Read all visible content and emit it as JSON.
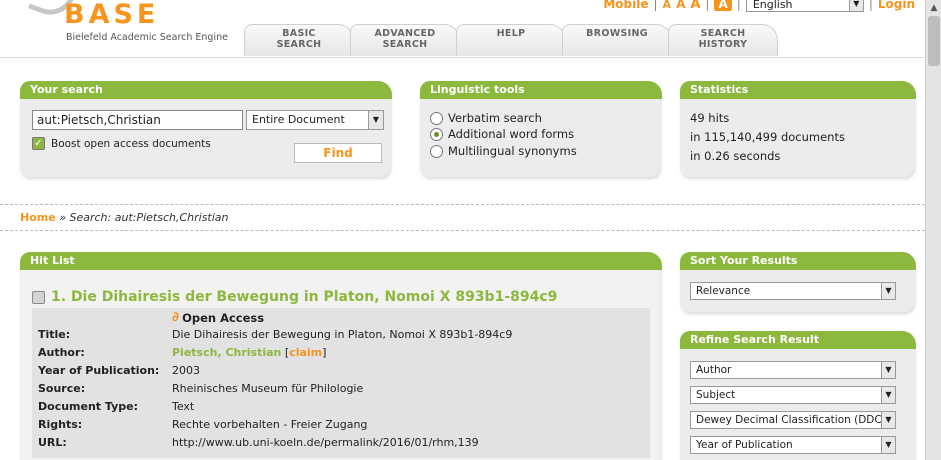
{
  "header": {
    "logo_text": "BASE",
    "logo_subtitle": "Bielefeld Academic Search Engine",
    "mobile_link": "Mobile",
    "font_sizes": [
      "A",
      "A",
      "A",
      "A"
    ],
    "language": "English",
    "login_link": "Login",
    "tabs": [
      {
        "label": "BASIC\nSEARCH"
      },
      {
        "label": "ADVANCED\nSEARCH"
      },
      {
        "label": "HELP"
      },
      {
        "label": "BROWSING"
      },
      {
        "label": "SEARCH\nHISTORY"
      }
    ]
  },
  "your_search": {
    "title": "Your search",
    "query": "aut:Pietsch,Christian",
    "scope": "Entire Document",
    "boost_label": "Boost open access documents",
    "boost_checked": true,
    "find_label": "Find"
  },
  "linguistics": {
    "title": "Linguistic tools",
    "options": [
      {
        "label": "Verbatim search",
        "selected": false
      },
      {
        "label": "Additional word forms",
        "selected": true
      },
      {
        "label": "Multilingual synonyms",
        "selected": false
      }
    ]
  },
  "statistics": {
    "title": "Statistics",
    "hits": "49 hits",
    "documents": "in 115,140,499 documents",
    "time": "in 0.26 seconds"
  },
  "breadcrumb": {
    "home": "Home",
    "separator": "»",
    "current": "Search: aut:Pietsch,Christian"
  },
  "hit_list": {
    "title": "Hit List",
    "items": [
      {
        "number": "1.",
        "title": "Die Dihairesis der Bewegung in Platon, Nomoi X 893b1-894c9",
        "open_access": "Open Access",
        "fields": [
          {
            "label": "Title:",
            "value": "Die Dihairesis der Bewegung in Platon, Nomoi X 893b1-894c9"
          },
          {
            "label": "Author:",
            "value": "Pietsch, Christian",
            "claim": "claim"
          },
          {
            "label": "Year of Publication:",
            "value": "2003"
          },
          {
            "label": "Source:",
            "value": "Rheinisches Museum für Philologie"
          },
          {
            "label": "Document Type:",
            "value": "Text"
          },
          {
            "label": "Rights:",
            "value": "Rechte vorbehalten - Freier Zugang"
          },
          {
            "label": "URL:",
            "value": "http://www.ub.uni-koeln.de/permalink/2016/01/rhm,139"
          }
        ]
      }
    ]
  },
  "sort": {
    "title": "Sort Your Results",
    "value": "Relevance"
  },
  "refine": {
    "title": "Refine Search Result",
    "filters": [
      "Author",
      "Subject",
      "Dewey Decimal Classification (DDC)",
      "Year of Publication"
    ]
  },
  "colors": {
    "brand_orange": "#f7941d",
    "brand_green": "#8bb83d"
  }
}
